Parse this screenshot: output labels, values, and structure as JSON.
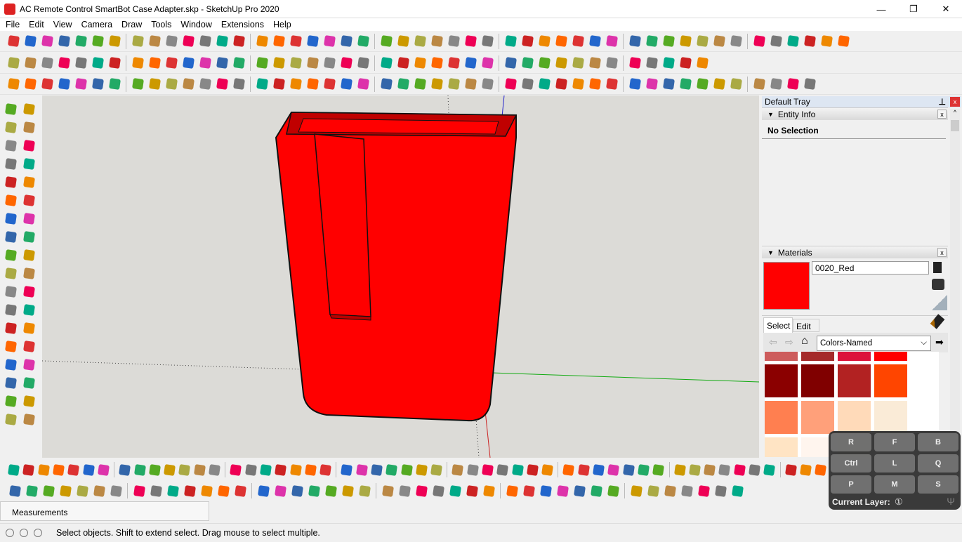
{
  "window": {
    "title": "AC Remote Control SmartBot Case Adapter.skp - SketchUp Pro 2020",
    "minimize": "—",
    "maximize": "❐",
    "close": "✕"
  },
  "menu": [
    "File",
    "Edit",
    "View",
    "Camera",
    "Draw",
    "Tools",
    "Window",
    "Extensions",
    "Help"
  ],
  "toolbar_colors": [
    "#d33",
    "#c22",
    "#e05",
    "#aa4",
    "#2a6",
    "#26c",
    "#e80",
    "#777",
    "#b84",
    "#5a2",
    "#d3a",
    "#f60",
    "#0a8",
    "#888",
    "#c90",
    "#36a"
  ],
  "tray": {
    "title": "Default Tray",
    "pin": "⊥",
    "close": "x",
    "entity_info": {
      "title": "Entity Info",
      "status": "No Selection"
    },
    "materials": {
      "title": "Materials",
      "name": "0020_Red",
      "color": "#ff0000",
      "tabs": [
        "Select",
        "Edit"
      ],
      "library": "Colors-Named",
      "swatches": [
        "#cd5c5c",
        "#a52a2a",
        "#dc143c",
        "#ff0000",
        "#8b0000",
        "#800000",
        "#b22222",
        "#ff4500",
        "#ff7f50",
        "#ffa07a",
        "#ffdab9",
        "#faebd7",
        "#ffe4c4",
        "#fff5ee",
        "#fdf5e6",
        "#ffffff"
      ]
    }
  },
  "measurements": {
    "label": "Measurements"
  },
  "status": {
    "text": "Select objects. Shift to extend select. Drag mouse to select multiple."
  },
  "shortcuts": {
    "keys": [
      "R",
      "F",
      "B",
      "Ctrl",
      "L",
      "Q",
      "P",
      "M",
      "S"
    ],
    "current_layer_label": "Current Layer:",
    "current_layer_value": "①"
  },
  "model": {
    "color": "#ff0000"
  }
}
